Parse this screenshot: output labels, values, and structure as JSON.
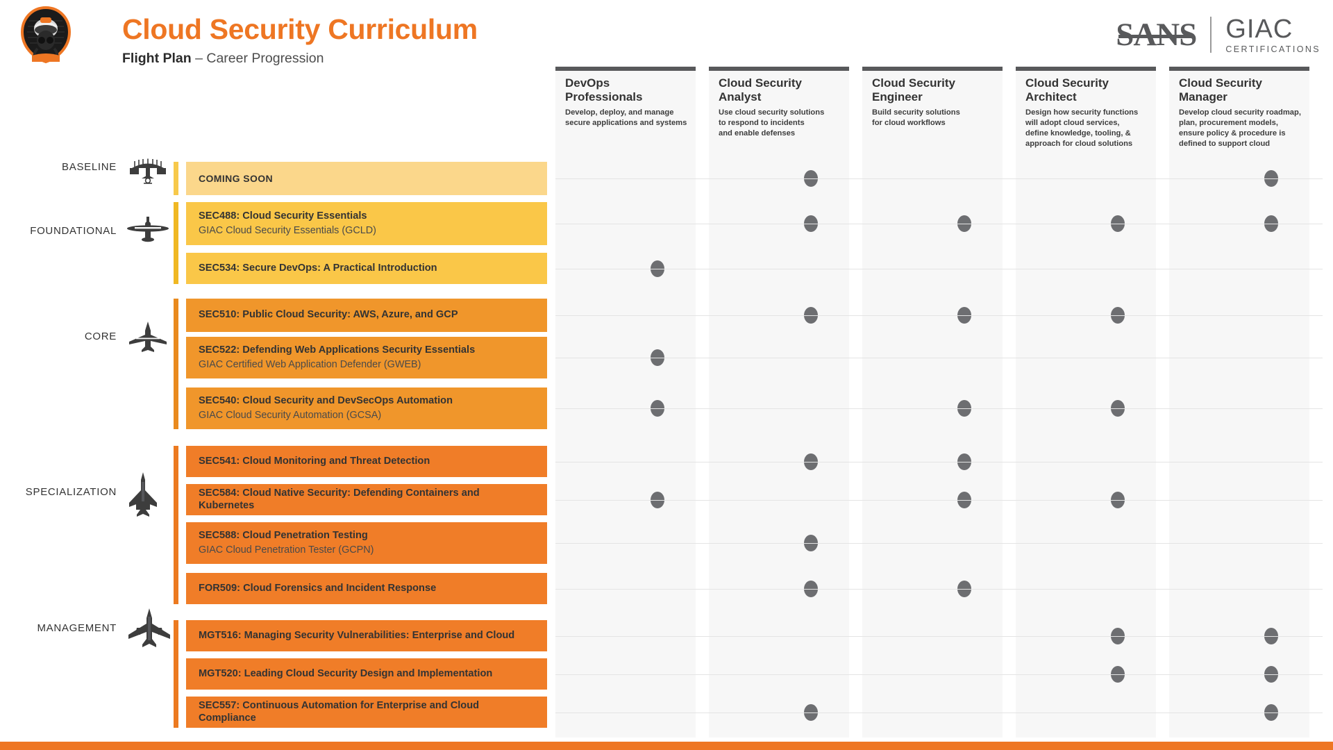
{
  "header": {
    "title": "Cloud Security Curriculum",
    "subtitle_bold": "Flight Plan",
    "subtitle_rest": "– Career Progression",
    "logo_icon": "pilot-helmet-badge-icon",
    "brand": {
      "sans": "SANS",
      "giac": "GIAC",
      "giac_sub": "CERTIFICATIONS"
    }
  },
  "accent_color": "#ee7623",
  "columns": [
    {
      "title": "DevOps Professionals",
      "description": "Develop, deploy, and manage\nsecure applications and systems"
    },
    {
      "title": "Cloud Security\nAnalyst",
      "description": "Use cloud security solutions\nto respond to incidents\nand enable defenses"
    },
    {
      "title": "Cloud Security\nEngineer",
      "description": "Build security solutions\nfor cloud workflows"
    },
    {
      "title": "Cloud Security\nArchitect",
      "description": "Design how security functions\nwill adopt cloud services,\ndefine knowledge, tooling, &\napproach for cloud solutions"
    },
    {
      "title": "Cloud Security\nManager",
      "description": "Develop cloud security roadmap,\nplan, procurement models,\nensure policy & procedure is\ndefined to support cloud"
    }
  ],
  "tiers": [
    {
      "label": "BASELINE",
      "icon": "biplane-icon",
      "color": "#fbd78b",
      "accent": "#f7c94b"
    },
    {
      "label": "FOUNDATIONAL",
      "icon": "propeller-plane-icon",
      "color": "#fac748",
      "accent": "#f0b823"
    },
    {
      "label": "CORE",
      "icon": "jetliner-icon",
      "color": "#f0962b",
      "accent": "#e98a1e"
    },
    {
      "label": "SPECIALIZATION",
      "icon": "fighter-jet-icon",
      "color": "#f07d28",
      "accent": "#ec7a20"
    },
    {
      "label": "MANAGEMENT",
      "icon": "airliner-icon",
      "color": "#f07d28",
      "accent": "#ec7a20"
    }
  ],
  "rows": [
    {
      "tier": 0,
      "code": "",
      "title": "COMING SOON",
      "cert": "",
      "dots": [
        0,
        1,
        0,
        0,
        1
      ]
    },
    {
      "tier": 1,
      "code": "SEC488:",
      "title": "SEC488: Cloud Security Essentials",
      "cert": "GIAC Cloud Security Essentials (GCLD)",
      "dots": [
        0,
        1,
        1,
        1,
        1
      ]
    },
    {
      "tier": 1,
      "code": "SEC534:",
      "title": "SEC534: Secure DevOps: A Practical Introduction",
      "cert": "",
      "dots": [
        1,
        0,
        0,
        0,
        0
      ]
    },
    {
      "tier": 2,
      "code": "SEC510:",
      "title": "SEC510: Public Cloud Security: AWS, Azure, and GCP",
      "cert": "",
      "dots": [
        0,
        1,
        1,
        1,
        0
      ]
    },
    {
      "tier": 2,
      "code": "SEC522:",
      "title": "SEC522: Defending Web Applications Security Essentials",
      "cert": "GIAC Certified Web Application Defender (GWEB)",
      "dots": [
        1,
        0,
        0,
        0,
        0
      ]
    },
    {
      "tier": 2,
      "code": "SEC540:",
      "title": "SEC540: Cloud Security and DevSecOps Automation",
      "cert": "GIAC Cloud Security Automation (GCSA)",
      "dots": [
        1,
        0,
        1,
        1,
        0
      ]
    },
    {
      "tier": 3,
      "code": "SEC541:",
      "title": "SEC541: Cloud Monitoring and Threat Detection",
      "cert": "",
      "dots": [
        0,
        1,
        1,
        0,
        0
      ]
    },
    {
      "tier": 3,
      "code": "SEC584:",
      "title": "SEC584: Cloud Native Security: Defending Containers and Kubernetes",
      "cert": "",
      "dots": [
        1,
        0,
        1,
        1,
        0
      ]
    },
    {
      "tier": 3,
      "code": "SEC588:",
      "title": "SEC588: Cloud Penetration Testing",
      "cert": "GIAC Cloud Penetration Tester (GCPN)",
      "dots": [
        0,
        1,
        0,
        0,
        0
      ]
    },
    {
      "tier": 3,
      "code": "FOR509:",
      "title": "FOR509: Cloud Forensics and Incident Response",
      "cert": "",
      "dots": [
        0,
        1,
        1,
        0,
        0
      ]
    },
    {
      "tier": 4,
      "code": "MGT516:",
      "title": "MGT516: Managing Security Vulnerabilities: Enterprise and Cloud",
      "cert": "",
      "dots": [
        0,
        0,
        0,
        1,
        1
      ]
    },
    {
      "tier": 4,
      "code": "MGT520:",
      "title": "MGT520: Leading Cloud Security Design and Implementation",
      "cert": "",
      "dots": [
        0,
        0,
        0,
        1,
        1
      ]
    },
    {
      "tier": 4,
      "code": "SEC557:",
      "title": "SEC557: Continuous Automation for Enterprise and Cloud Compliance",
      "cert": "",
      "dots": [
        0,
        1,
        0,
        0,
        1
      ]
    }
  ]
}
